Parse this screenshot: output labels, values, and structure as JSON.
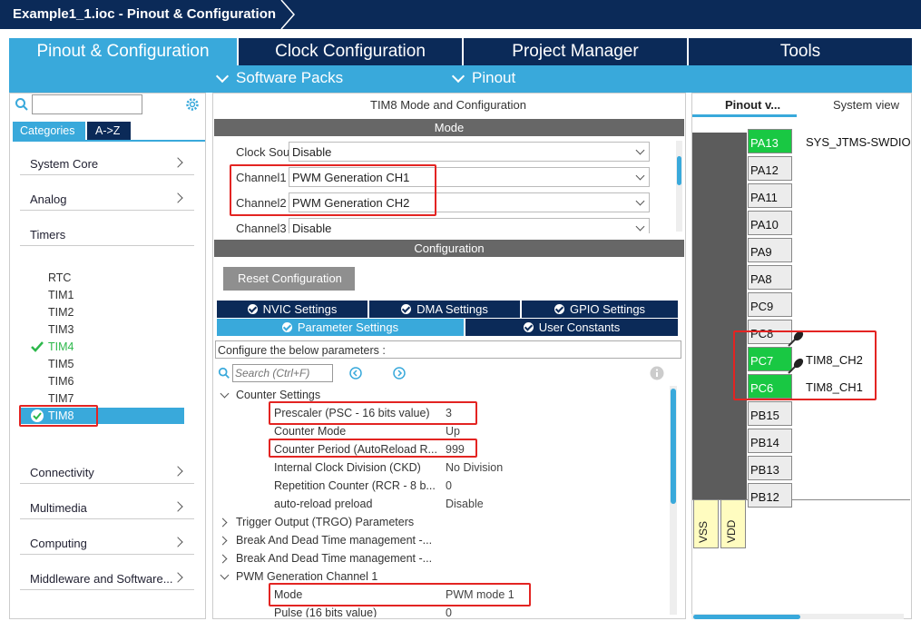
{
  "window": {
    "title": "Example1_1.ioc - Pinout & Configuration"
  },
  "tabs": [
    "Pinout & Configuration",
    "Clock Configuration",
    "Project Manager",
    "Tools"
  ],
  "subtabs": [
    "Software Packs",
    "Pinout"
  ],
  "left": {
    "search_placeholder": "",
    "tab_categories": "Categories",
    "tab_az": "A->Z",
    "categories_top": [
      "System Core",
      "Analog"
    ],
    "timers_label": "Timers",
    "timers": [
      "RTC",
      "TIM1",
      "TIM2",
      "TIM3",
      "TIM4",
      "TIM5",
      "TIM6",
      "TIM7",
      "TIM8"
    ],
    "categories_bottom": [
      "Connectivity",
      "Multimedia",
      "Computing",
      "Middleware and Software..."
    ]
  },
  "mode": {
    "panel_title": "TIM8 Mode and Configuration",
    "header": "Mode",
    "fields": [
      {
        "label": "Clock Source",
        "value": "Disable"
      },
      {
        "label": "Channel1",
        "value": "PWM Generation CH1"
      },
      {
        "label": "Channel2",
        "value": "PWM Generation CH2"
      },
      {
        "label": "Channel3",
        "value": "Disable"
      }
    ]
  },
  "config": {
    "header": "Configuration",
    "reset_button": "Reset Configuration",
    "tabs_row1": [
      "NVIC Settings",
      "DMA Settings",
      "GPIO Settings"
    ],
    "tabs_row2": [
      "Parameter Settings",
      "User Constants"
    ],
    "hint": "Configure the below parameters :",
    "search_placeholder": "Search (Ctrl+F)",
    "groups": {
      "counter": "Counter Settings",
      "trgo": "Trigger Output (TRGO) Parameters",
      "bdt1": "Break And Dead Time management -...",
      "bdt2": "Break And Dead Time management -...",
      "pwm1": "PWM Generation Channel 1"
    },
    "params": [
      {
        "name": "Prescaler (PSC - 16 bits value)",
        "value": "3"
      },
      {
        "name": "Counter Mode",
        "value": "Up"
      },
      {
        "name": "Counter Period (AutoReload R...",
        "value": "999"
      },
      {
        "name": "Internal Clock Division (CKD)",
        "value": "No Division"
      },
      {
        "name": "Repetition Counter (RCR - 8 b...",
        "value": "0"
      },
      {
        "name": "auto-reload preload",
        "value": "Disable"
      }
    ],
    "pwm_params": [
      {
        "name": "Mode",
        "value": "PWM mode 1"
      },
      {
        "name": "Pulse (16 bits value)",
        "value": "0"
      }
    ]
  },
  "pinout": {
    "tab_pinout": "Pinout v...",
    "tab_system": "System view",
    "pins": [
      {
        "name": "PA13",
        "label": "SYS_JTMS-SWDIO",
        "color": "#19c843"
      },
      {
        "name": "PA12",
        "label": "",
        "color": ""
      },
      {
        "name": "PA11",
        "label": "",
        "color": ""
      },
      {
        "name": "PA10",
        "label": "",
        "color": ""
      },
      {
        "name": "PA9",
        "label": "",
        "color": ""
      },
      {
        "name": "PA8",
        "label": "",
        "color": ""
      },
      {
        "name": "PC9",
        "label": "",
        "color": ""
      },
      {
        "name": "PC8",
        "label": "",
        "color": ""
      },
      {
        "name": "PC7",
        "label": "TIM8_CH2",
        "color": "#19c843"
      },
      {
        "name": "PC6",
        "label": "TIM8_CH1",
        "color": "#19c843"
      },
      {
        "name": "PB15",
        "label": "",
        "color": ""
      },
      {
        "name": "PB14",
        "label": "",
        "color": ""
      },
      {
        "name": "PB13",
        "label": "",
        "color": ""
      },
      {
        "name": "PB12",
        "label": "",
        "color": ""
      }
    ],
    "bottom_pins": [
      "VSS",
      "VDD"
    ]
  },
  "colors": {
    "navy": "#0b2a58",
    "accent": "#39a9db",
    "highlight_red": "#e32422",
    "pin_green": "#19c843"
  }
}
